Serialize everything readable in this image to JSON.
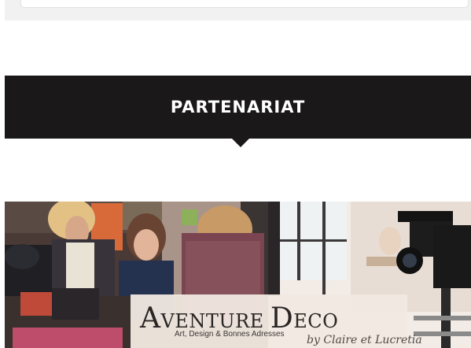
{
  "section": {
    "title": "PARTENARIAT"
  },
  "partner": {
    "logo_text": "Aventure Deco",
    "logo_initial_1": "A",
    "logo_rest_1": "VENTURE",
    "logo_initial_2": "D",
    "logo_rest_2": "ECO",
    "logo_subtitle": "Art, Design & Bonnes Adresses",
    "logo_signature": "by Claire et Lucretia"
  },
  "colors": {
    "banner_background": "#1a1818",
    "banner_text": "#ffffff",
    "page_background": "#ffffff"
  }
}
